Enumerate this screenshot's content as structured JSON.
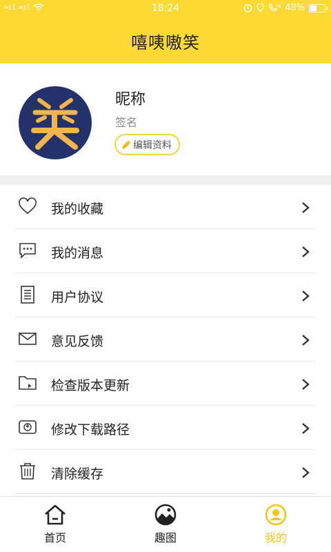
{
  "status_bar": {
    "signal_left": "≈ıl",
    "signal_left2": "≈ıl",
    "time": "18:24",
    "battery_text": "48%",
    "battery_level": 0.48
  },
  "header": {
    "title": "嘻咦嗷笑"
  },
  "profile": {
    "nickname": "昵称",
    "signature": "签名",
    "edit_label": "编辑资料"
  },
  "menu": {
    "items": [
      {
        "label": "我的收藏",
        "icon": "heart-icon"
      },
      {
        "label": "我的消息",
        "icon": "chat-bubble-icon"
      },
      {
        "label": "用户协议",
        "icon": "document-icon"
      },
      {
        "label": "意见反馈",
        "icon": "envelope-icon"
      },
      {
        "label": "检查版本更新",
        "icon": "folder-icon"
      },
      {
        "label": "修改下载路径",
        "icon": "storage-card-icon"
      },
      {
        "label": "清除缓存",
        "icon": "trash-icon"
      }
    ]
  },
  "tabbar": {
    "tabs": [
      {
        "label": "首页",
        "icon": "home-icon"
      },
      {
        "label": "趣图",
        "icon": "picture-icon"
      },
      {
        "label": "我的",
        "icon": "profile-icon",
        "active": true
      }
    ]
  },
  "colors": {
    "accent_yellow": "#fcd933",
    "active_tab": "#f6c518",
    "avatar_bg": "#23326b",
    "avatar_glyph": "#f3b44b"
  }
}
